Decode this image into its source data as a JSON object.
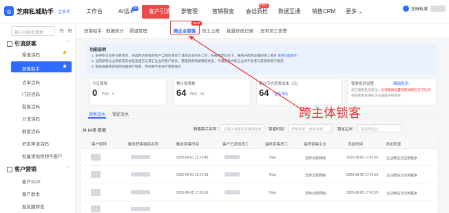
{
  "brand": {
    "name": "芝麻私域助手",
    "tag": "企业号"
  },
  "nav": {
    "items": [
      "工作台",
      "AI话术",
      "客户引流",
      "群管理",
      "营销裂变",
      "会话质检",
      "数据互通",
      "销售CRM",
      "更多 ⌄"
    ],
    "badges": {
      "ai": "AI",
      "huihua": "HOT"
    }
  },
  "user": {
    "name": "芝麻私域"
  },
  "sidebar": {
    "search_placeholder": "输入功能名搜索",
    "group1": "引流获客",
    "group2": "客户营销",
    "items1": [
      "渠道活码",
      "获客助手",
      "点单活码",
      "门店活码",
      "裂客活码",
      "分流活码",
      "群客活码",
      "好友申请活码",
      "批量添加视频号客户"
    ],
    "items2": [
      "客户SOP",
      "客户群发",
      "朋友圈群发"
    ]
  },
  "subnav": {
    "items": [
      "获客助手",
      "数据统计",
      "渠道管理",
      "跨企业锁客",
      "员工上限",
      "批量修改记录",
      "异常员工告警"
    ],
    "new_badge": "NEW"
  },
  "notice": {
    "title": "功能说明",
    "lines": [
      "1. 支持多企业参与获客时，点选跨企获客的客户当前已添加了其他企业的员工时，在被锁定状态下，重新分配到正确的员工名片",
      "2. 当前获客企业获客逆向会检查是否与其它企业的客户联系，若是则保持被锁定状态，不满足条件的企业将不会参与获客的客户锁定",
      "3. 需先设置锁定规则后再进行锁客，否则将不会进行锁客操作"
    ],
    "link": "查看功能指引"
  },
  "cards": [
    {
      "title": "今日锁客",
      "value": "0",
      "sub": "昨日：0"
    },
    {
      "title": "累计锁客数",
      "value": "64",
      "sub": "昨日：64"
    },
    {
      "title": "累计节约获客成本（元）",
      "value": "64",
      "link": "查看详情"
    }
  ],
  "tip": {
    "title": "锁客规则设置",
    "link": "编辑规则 ›",
    "line1": "如已锁客且未成功，",
    "line1_red": "必须重新设置锁客规则后方可生效",
    "line2": "规则变更后将在次日凌晨开始生效"
  },
  "tabs": [
    "锁客流水",
    "锁定流水"
  ],
  "filter": {
    "count": "共 64条 数据",
    "label1": "获客助手名称：",
    "placeholder1": "请输入获客助手链接名称",
    "label2": "锁客时间：",
    "placeholder2": "开始日期 ~ 结束日期",
    "label3": "锁定企业：",
    "placeholder3": "请选择企业"
  },
  "table": {
    "headers": [
      "客户昵称",
      "触发获客链接名称",
      "触发锁客时间",
      "客户已添加员工",
      "最终锁客员工",
      "最终锁客企业",
      "添加时间",
      "添加来源"
    ],
    "rows": [
      {
        "time": "2025-09-01 15:10:45",
        "staff": "Niya",
        "corp": "芝麻云鸦网络",
        "add": "2025-08-05 17:42:25",
        "src": "企业微信方应用程序"
      },
      {
        "time": "2025-09-01 15:10:18",
        "staff": "Niya",
        "corp": "芝麻云鸦网络",
        "add": "2025-08-05 17:42:25",
        "src": "企业微信方应用程序"
      },
      {
        "time": "2025-08-05 17:50:19",
        "staff": "Niya",
        "corp": "芝麻云鸦网络",
        "add": "2025-08-05 17:42:25",
        "src": "企业微信方应用程序"
      }
    ]
  },
  "annotation": "跨主体锁客",
  "colors": {
    "accent": "#2f6bff",
    "annot": "#e33333",
    "nav_active": "#e94a4a"
  }
}
